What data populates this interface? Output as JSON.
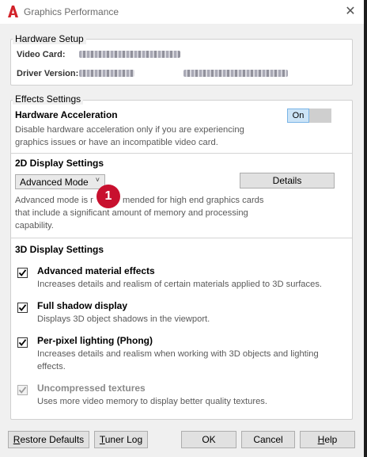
{
  "window": {
    "title": "Graphics Performance",
    "app_icon": "autocad-a-icon",
    "close_glyph": "✕"
  },
  "hardware": {
    "legend": "Hardware Setup",
    "video_card_label": "Video Card:",
    "driver_version_label": "Driver Version:"
  },
  "effects": {
    "legend": "Effects Settings",
    "accel_title": "Hardware Acceleration",
    "accel_desc_1": "Disable hardware acceleration only if you are experiencing",
    "accel_desc_2": "graphics issues or have an incompatible video card.",
    "toggle_label": "On"
  },
  "display2d": {
    "title": "2D Display Settings",
    "mode_value": "Advanced Mode",
    "details_label": "Details",
    "desc_1": "Advanced mode is r",
    "desc_1b": "mended for high end graphics cards",
    "desc_2": "that include a significant amount of memory and processing",
    "desc_3": "capability.",
    "badge": "1"
  },
  "display3d": {
    "title": "3D Display Settings",
    "options": [
      {
        "title": "Advanced material effects",
        "desc1": "Increases details and realism of certain materials applied to 3D surfaces.",
        "desc2": ""
      },
      {
        "title": "Full shadow display",
        "desc1": "Displays 3D object shadows in the viewport.",
        "desc2": ""
      },
      {
        "title": "Per-pixel lighting (Phong)",
        "desc1": "Increases details and realism when working with 3D objects and lighting",
        "desc2": "effects."
      },
      {
        "title": "Uncompressed textures",
        "desc1": "Uses more video memory to display better quality textures.",
        "desc2": ""
      }
    ]
  },
  "footer": {
    "restore_first": "R",
    "restore_rest": "estore Defaults",
    "tuner_first": "T",
    "tuner_rest": "uner Log",
    "ok": "OK",
    "cancel": "Cancel",
    "help_first": "H",
    "help_rest": "elp"
  }
}
